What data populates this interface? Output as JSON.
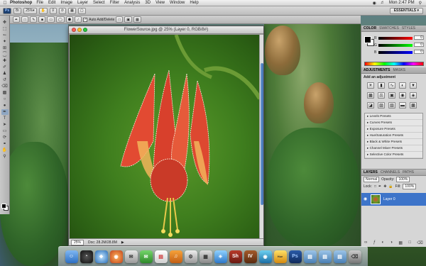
{
  "menubar": {
    "app": "Photoshop",
    "menus": [
      "File",
      "Edit",
      "Image",
      "Layer",
      "Select",
      "Filter",
      "Analysis",
      "3D",
      "View",
      "Window",
      "Help"
    ],
    "clock": "Mon 2:47 PM"
  },
  "options": {
    "zoom": "25%",
    "workspace": "ESSENTIALS ▾",
    "auto_add_delete": "Auto Add/Delete"
  },
  "document": {
    "title": "FlowerSource.jpg @ 25% (Layer 0, RGB/8#)",
    "status_zoom": "25%",
    "status_doc": "Doc: 28.2M/28.8M"
  },
  "panels": {
    "color_tabs": [
      "COLOR",
      "SWATCHES",
      "STYLES"
    ],
    "rgb": [
      {
        "label": "R",
        "value": "0"
      },
      {
        "label": "G",
        "value": "0"
      },
      {
        "label": "B",
        "value": "0"
      }
    ],
    "adj_tabs": [
      "ADJUSTMENTS",
      "MASKS"
    ],
    "adj_heading": "Add an adjustment",
    "presets": [
      "Levels Presets",
      "Curves Presets",
      "Exposure Presets",
      "Hue/Saturation Presets",
      "Black & White Presets",
      "Channel Mixer Presets",
      "Selective Color Presets"
    ],
    "layers_tabs": [
      "LAYERS",
      "CHANNELS",
      "PATHS"
    ],
    "blend_mode": "Normal",
    "opacity_label": "Opacity:",
    "opacity": "100%",
    "lock_label": "Lock:",
    "fill_label": "Fill:",
    "fill": "100%",
    "layer_name": "Layer 0"
  },
  "dock": {
    "ps_label": "Ps",
    "sh_label": "Sh",
    "iv_label": "IV",
    "hue_label": "Hue"
  }
}
